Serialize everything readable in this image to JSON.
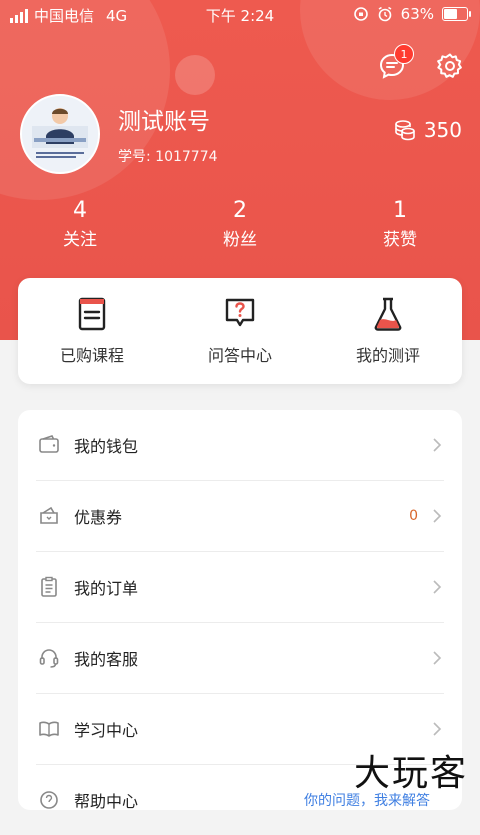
{
  "status": {
    "carrier": "中国电信",
    "network": "4G",
    "time": "下午 2:24",
    "battery": "63%",
    "battery_level": 0.63
  },
  "header": {
    "message_badge": "1"
  },
  "profile": {
    "name": "测试账号",
    "student_id": "学号: 1017774",
    "coins": "350"
  },
  "stats": [
    {
      "num": "4",
      "label": "关注"
    },
    {
      "num": "2",
      "label": "粉丝"
    },
    {
      "num": "1",
      "label": "获赞"
    }
  ],
  "quick": [
    {
      "label": "已购课程"
    },
    {
      "label": "问答中心"
    },
    {
      "label": "我的测评"
    }
  ],
  "menu": [
    {
      "label": "我的钱包",
      "extra": ""
    },
    {
      "label": "优惠券",
      "extra": "0"
    },
    {
      "label": "我的订单",
      "extra": ""
    },
    {
      "label": "我的客服",
      "extra": ""
    },
    {
      "label": "学习中心",
      "extra": ""
    },
    {
      "label": "帮助中心",
      "extra": "你的问题，我来解答"
    }
  ],
  "watermark": "大玩客",
  "colors": {
    "header": "#e9544b",
    "badge": "#ff3b30",
    "coupon_count": "#d8662b",
    "link": "#3f7fe2"
  }
}
